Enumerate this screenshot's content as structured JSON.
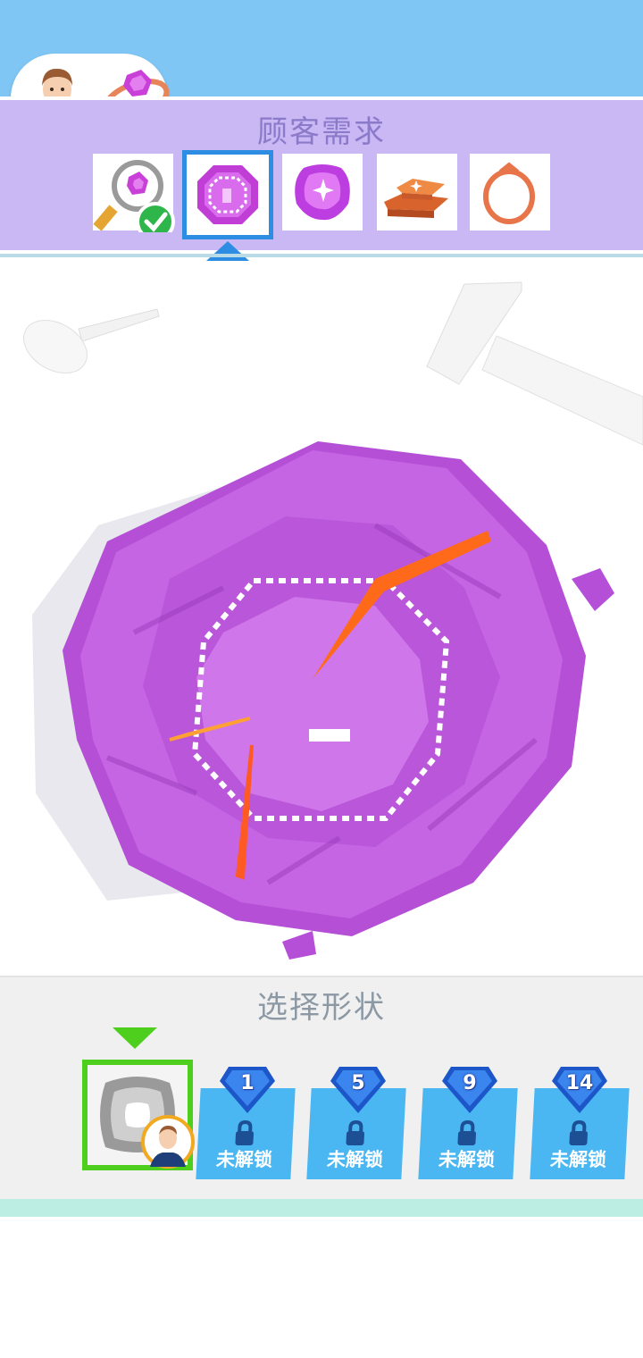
{
  "header": {
    "customer_avatar_icon": "customer-avatar-icon",
    "requested_item_icon": "purple-ring-icon",
    "title": "顾客需求"
  },
  "steps": [
    {
      "name": "inspect",
      "icon": "magnifier-gem-icon",
      "completed": true
    },
    {
      "name": "cut-shape",
      "icon": "octagon-gem-icon",
      "active": true
    },
    {
      "name": "polish",
      "icon": "polished-gem-icon"
    },
    {
      "name": "gold",
      "icon": "gold-bar-icon"
    },
    {
      "name": "ring",
      "icon": "ring-icon"
    }
  ],
  "shape_selector": {
    "title": "选择形状",
    "selected": {
      "icon": "cushion-shape-icon",
      "badge_icon": "customer-avatar-icon"
    },
    "locked_items": [
      {
        "cost": "1",
        "label": "未解锁"
      },
      {
        "cost": "5",
        "label": "未解锁"
      },
      {
        "cost": "9",
        "label": "未解锁"
      },
      {
        "cost": "14",
        "label": "未解锁"
      }
    ]
  },
  "colors": {
    "sky": "#7fc6f5",
    "panel": "#c9b8f4",
    "active_step_border": "#2c8de2",
    "gem": "#b44fd6",
    "selected_border": "#4fcf1d",
    "locked_card": "#4ab6f2"
  }
}
